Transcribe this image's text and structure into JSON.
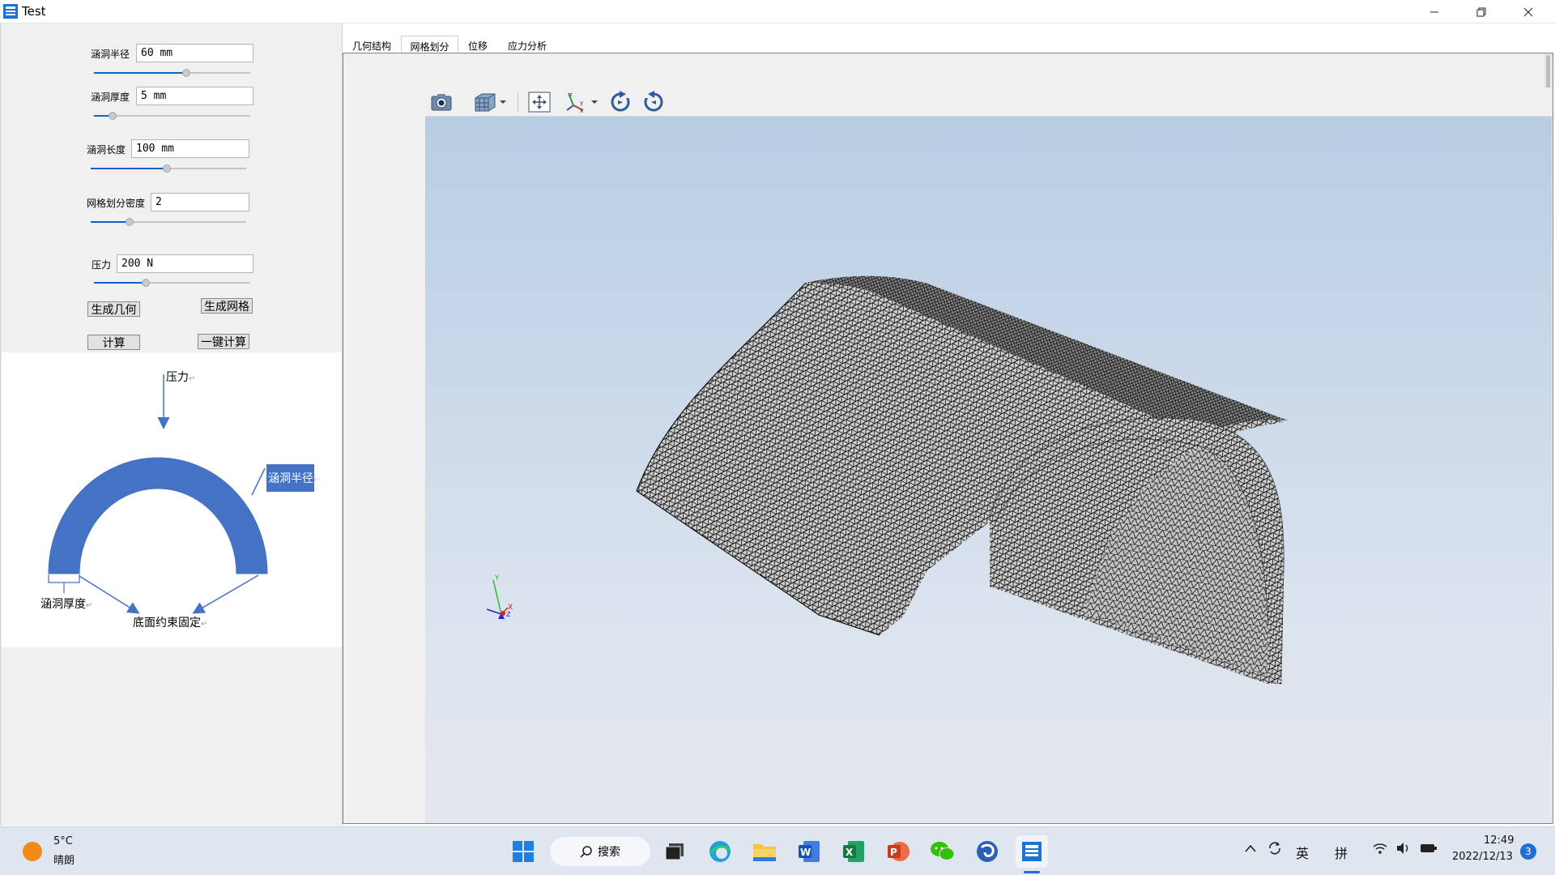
{
  "window": {
    "title": "Test"
  },
  "params": {
    "radius": {
      "label": "涵洞半径",
      "value": "60 mm",
      "level": 0.59
    },
    "thickness": {
      "label": "涵洞厚度",
      "value": "5 mm",
      "level": 0.12
    },
    "length": {
      "label": "涵洞长度",
      "value": "100 mm",
      "level": 0.49
    },
    "mesh_density": {
      "label": "网格划分密度",
      "value": "2",
      "level": 0.25
    },
    "pressure": {
      "label": "压力",
      "value": "200 N",
      "level": 0.33
    }
  },
  "buttons": {
    "gen_geometry": "生成几何",
    "gen_mesh": "生成网格",
    "compute": "计算",
    "one_click": "一键计算"
  },
  "diagram": {
    "pressure": "压力",
    "radius": "涵洞半径",
    "thickness": "涵洞厚度",
    "constraint": "底面约束固定",
    "mark": "↵",
    "arch_color": "#4472c4"
  },
  "tabs": [
    {
      "label": "几何结构",
      "active": false
    },
    {
      "label": "网格划分",
      "active": true
    },
    {
      "label": "位移",
      "active": false
    },
    {
      "label": "应力分析",
      "active": false
    }
  ],
  "toolbar": [
    "camera-icon",
    "view-cube-icon",
    "fit-view-icon",
    "axes-icon",
    "rotate-cw-icon",
    "rotate-ccw-icon"
  ],
  "axes": {
    "y": "Y",
    "x": "X",
    "z": "Z"
  },
  "taskbar": {
    "weather_temp": "5°C",
    "weather_desc": "晴朗",
    "search_label": "搜索",
    "ime_lang": "英",
    "ime_mode": "拼",
    "time": "12:49",
    "date": "2022/12/13",
    "notifications": "3"
  }
}
